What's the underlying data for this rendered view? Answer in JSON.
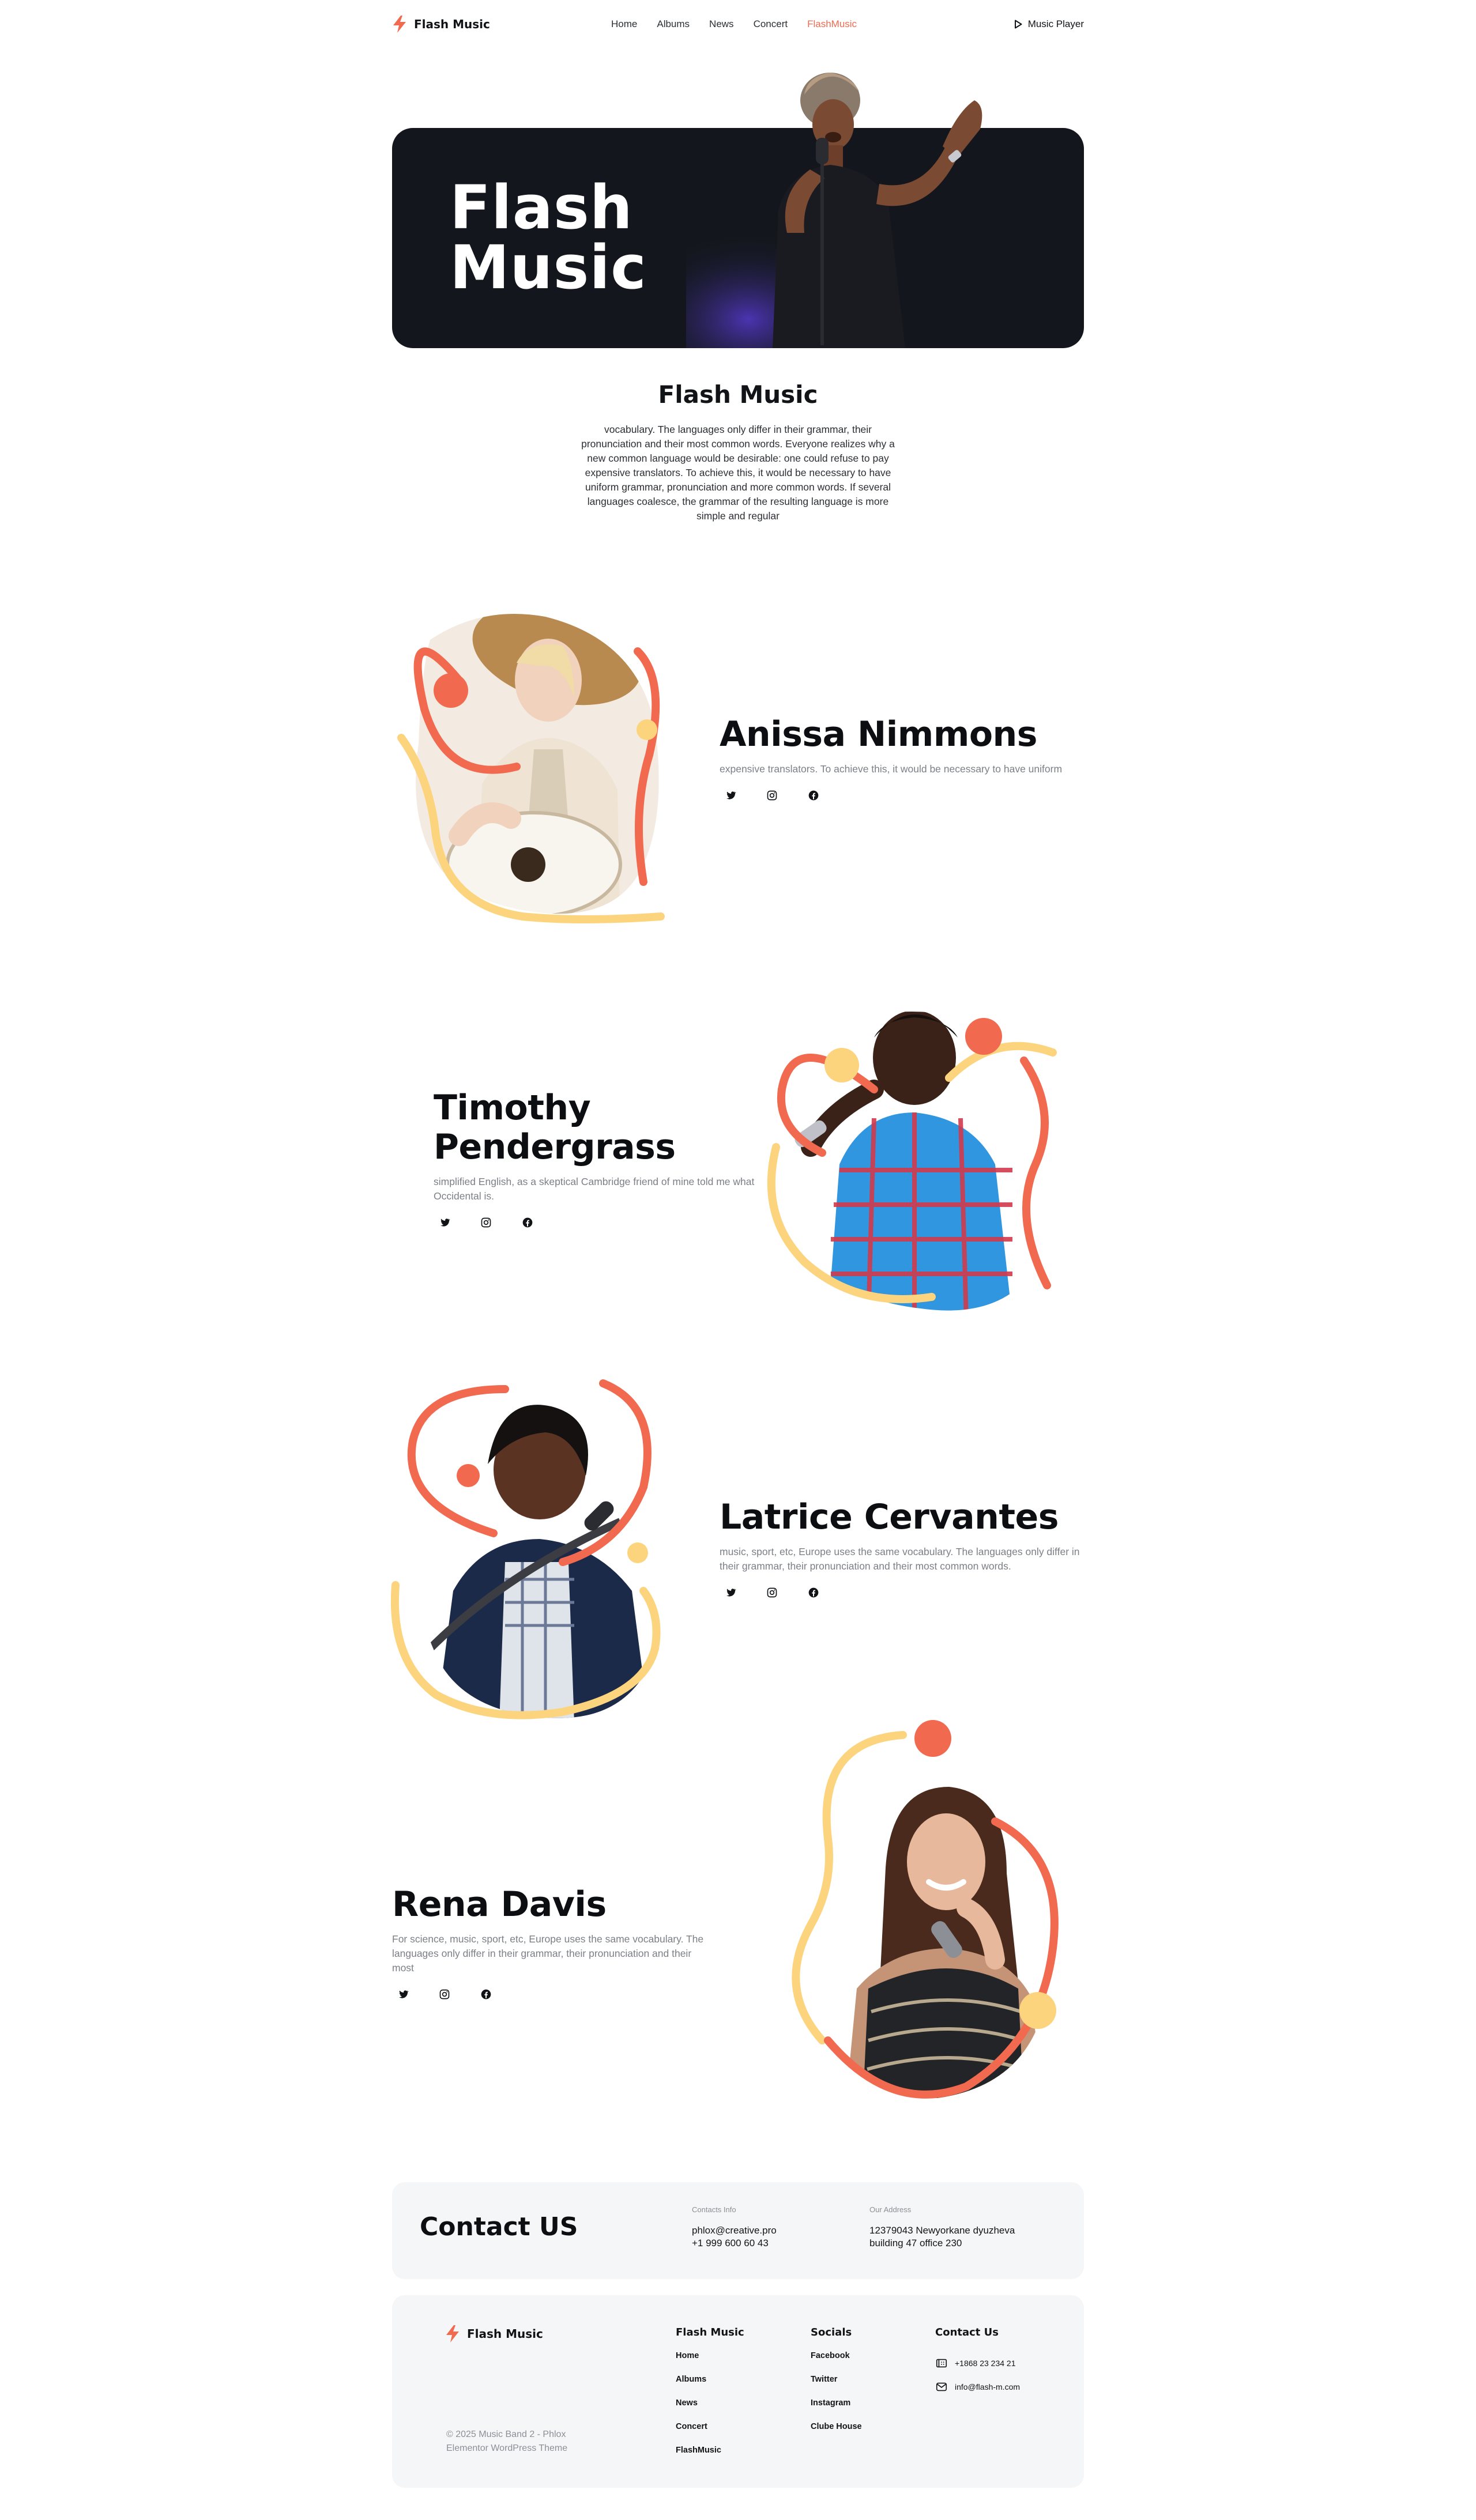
{
  "header": {
    "logo_text": "Flash Music",
    "nav": [
      "Home",
      "Albums",
      "News",
      "Concert",
      "FlashMusic"
    ],
    "active_nav": "FlashMusic",
    "player_label": "Music Player"
  },
  "hero": {
    "title_line1": "Flash",
    "title_line2": "Music"
  },
  "intro": {
    "title": "Flash Music",
    "body": "vocabulary. The languages only differ in their grammar, their pronunciation and their most common words. Everyone realizes why a new common language would be desirable: one could refuse to pay expensive translators. To achieve this, it would be necessary to have uniform grammar, pronunciation and more common words. If several languages coalesce, the grammar of the resulting language is more simple and regular"
  },
  "artists": [
    {
      "name": "Anissa Nimmons",
      "desc": "expensive translators. To achieve this, it would be necessary to have uniform"
    },
    {
      "name_line1": "Timothy",
      "name_line2": "Pendergrass",
      "desc": "simplified English, as a skeptical Cambridge friend of mine told me what Occidental is."
    },
    {
      "name": "Latrice Cervantes",
      "desc": "music, sport, etc, Europe uses the same vocabulary. The languages only differ in their grammar, their pronunciation and their most common words."
    },
    {
      "name": "Rena Davis",
      "desc": "For science, music, sport, etc, Europe uses the same vocabulary. The languages only differ in their grammar, their pronunciation and their most"
    }
  ],
  "social_icons": [
    "twitter-icon",
    "instagram-icon",
    "facebook-icon"
  ],
  "contact": {
    "title": "Contact US",
    "info_label": "Contacts Info",
    "email": "phlox@creative.pro",
    "phone": "+1 999 600 60 43",
    "address_label": "Our Address",
    "address_line1": "12379043 Newyorkane dyuzheva",
    "address_line2": "building 47 office 230"
  },
  "footer": {
    "logo_text": "Flash Music",
    "copyright": "© 2025 Music Band 2 - Phlox Elementor WordPress Theme",
    "col1_title": "Flash Music",
    "col1_items": [
      "Home",
      "Albums",
      "News",
      "Concert",
      "FlashMusic"
    ],
    "col2_title": "Socials",
    "col2_items": [
      "Facebook",
      "Twitter",
      "Instagram",
      "Clube House"
    ],
    "col3_title": "Contact Us",
    "phone": "+1868 23 234 21",
    "email": "info@flash-m.com"
  },
  "colors": {
    "accent": "#f16a50",
    "yellow": "#fdd47e",
    "dark": "#13171d",
    "panel": "#f5f6f8"
  }
}
